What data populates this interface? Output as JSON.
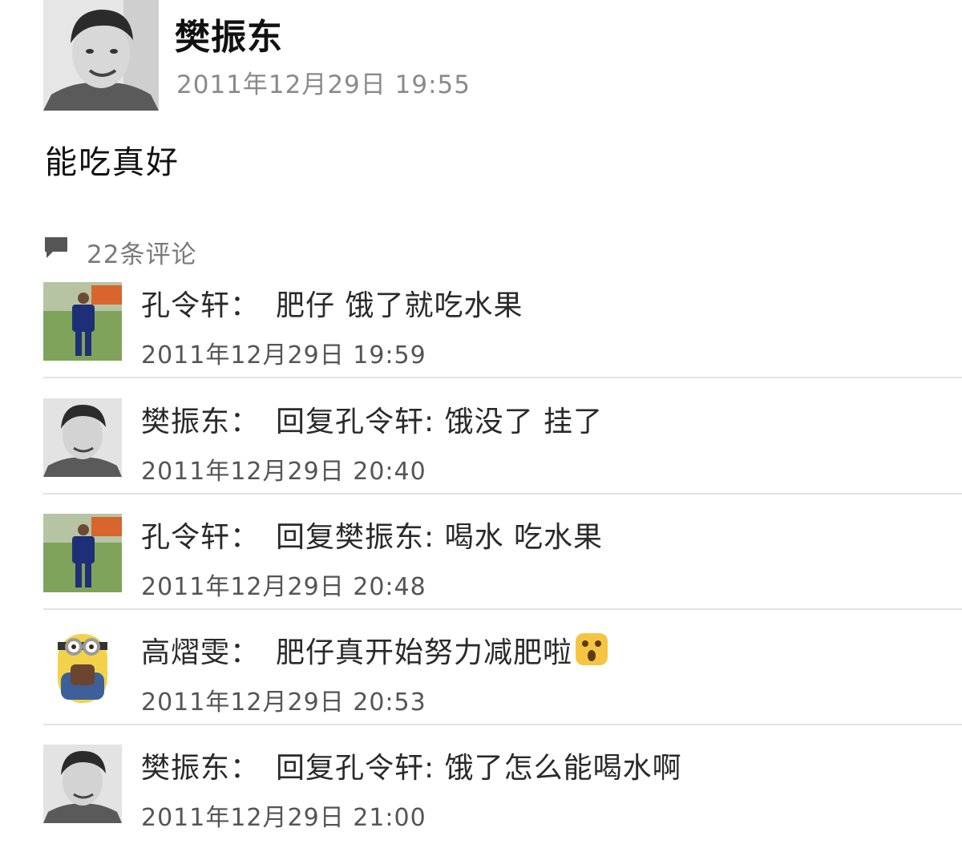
{
  "post": {
    "author": "樊振东",
    "time": "2011年12月29日 19:55",
    "content": "能吃真好"
  },
  "comments_header": {
    "count_label": "22条评论",
    "icon": "speech-bubble-icon"
  },
  "comments": [
    {
      "name": "孔令轩",
      "text": "肥仔 饿了就吃水果",
      "time": "2011年12月29日 19:59",
      "avatar": "boy-on-field-avatar"
    },
    {
      "name": "樊振东",
      "text": "回复孔令轩: 饿没了 挂了",
      "time": "2011年12月29日 20:40",
      "avatar": "smiling-boy-avatar"
    },
    {
      "name": "孔令轩",
      "text": "回复樊振东: 喝水 吃水果",
      "time": "2011年12月29日 20:48",
      "avatar": "boy-on-field-avatar"
    },
    {
      "name": "高熠雯",
      "text": "肥仔真开始努力减肥啦",
      "time": "2011年12月29日 20:53",
      "avatar": "minion-avatar",
      "emoji": "surprised-face-emoji"
    },
    {
      "name": "樊振东",
      "text": "回复孔令轩: 饿了怎么能喝水啊",
      "time": "2011年12月29日 21:00",
      "avatar": "smiling-boy-avatar"
    }
  ],
  "colors": {
    "text": "#1f1f1f",
    "meta": "#8a8a8a",
    "divider": "#e3e3e3",
    "emoji_yellow": "#f5c542"
  }
}
